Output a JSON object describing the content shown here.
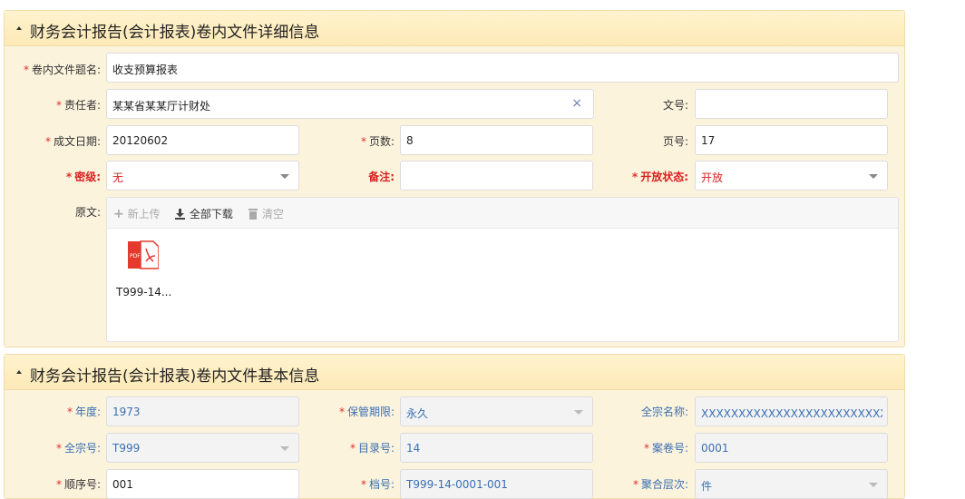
{
  "detail_panel": {
    "title": "财务会计报告(会计报表)卷内文件详细信息",
    "fields": {
      "title_label": "卷内文件题名:",
      "title_value": "收支预算报表",
      "responsible_label": "责任者:",
      "responsible_value": "某某省某某厅计财处",
      "doc_no_label": "文号:",
      "doc_no_value": "",
      "date_label": "成文日期:",
      "date_value": "20120602",
      "pages_label": "页数:",
      "pages_value": "8",
      "page_no_label": "页号:",
      "page_no_value": "17",
      "secret_label": "密级:",
      "secret_value": "无",
      "remark_label": "备注:",
      "remark_value": "",
      "open_label": "开放状态:",
      "open_value": "开放",
      "original_label": "原文:"
    },
    "toolbar": {
      "upload": "新上传",
      "download_all": "全部下载",
      "clear": "清空"
    },
    "file": {
      "name": "T999-14...",
      "badge": "PDF"
    },
    "clear_symbol": "×",
    "required_mark": "*"
  },
  "basic_panel": {
    "title": "财务会计报告(会计报表)卷内文件基本信息",
    "fields": {
      "year_label": "年度:",
      "year_value": "1973",
      "retention_label": "保管期限:",
      "retention_value": "永久",
      "fonds_name_label": "全宗名称:",
      "fonds_name_value": "XXXXXXXXXXXXXXXXXXXXXXXXXXXXXXX厅",
      "fonds_no_label": "全宗号:",
      "fonds_no_value": "T999",
      "catalog_label": "目录号:",
      "catalog_value": "14",
      "volume_label": "案卷号:",
      "volume_value": "0001",
      "seq_label": "顺序号:",
      "seq_value": "001",
      "archive_no_label": "档号:",
      "archive_no_value": "T999-14-0001-001",
      "level_label": "聚合层次:",
      "level_value": "件"
    }
  },
  "colors": {
    "required": "#e0302b",
    "header_bg": "#fde9b7",
    "panel_bg": "#fcf3dd",
    "value_blue": "#3a6fb3"
  }
}
